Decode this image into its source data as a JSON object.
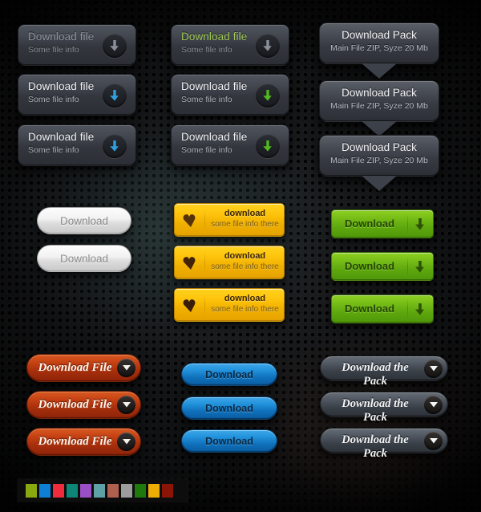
{
  "meta": {
    "title": "Download Buttons UI Kit",
    "background_style": "dark perforated metal texture"
  },
  "column_dark_blue": {
    "name": "Dark buttons with blue arrow",
    "buttons": [
      {
        "title": "Download file",
        "subtitle": "Some file info",
        "state": "disabled",
        "icon": "download-arrow-icon",
        "arrow_color": "#8a8f98"
      },
      {
        "title": "Download file",
        "subtitle": "Some file info",
        "state": "hover",
        "icon": "download-arrow-icon",
        "arrow_color": "#2f9fe0"
      },
      {
        "title": "Download file",
        "subtitle": "Some file info",
        "state": "active",
        "icon": "download-arrow-icon",
        "arrow_color": "#2f9fe0"
      }
    ]
  },
  "column_dark_green": {
    "name": "Dark buttons with green arrow",
    "buttons": [
      {
        "title": "Download file",
        "subtitle": "Some file info",
        "state": "disabled",
        "icon": "download-arrow-icon",
        "arrow_color": "#8a8f98",
        "title_color": "#9dc559"
      },
      {
        "title": "Download file",
        "subtitle": "Some file info",
        "state": "hover",
        "icon": "download-arrow-icon",
        "arrow_color": "#52b81f",
        "title_color": "#f2f3f5"
      },
      {
        "title": "Download file",
        "subtitle": "Some file info",
        "state": "active",
        "icon": "download-arrow-icon",
        "arrow_color": "#52b81f",
        "title_color": "#f2f3f5"
      }
    ]
  },
  "column_pack_tags": {
    "name": "Download Pack tag buttons",
    "buttons": [
      {
        "title": "Download Pack",
        "subtitle": "Main File ZIP, Syze 20 Mb"
      },
      {
        "title": "Download Pack",
        "subtitle": "Main File ZIP, Syze 20 Mb"
      },
      {
        "title": "Download Pack",
        "subtitle": "Main File ZIP, Syze 20 Mb"
      }
    ]
  },
  "white_pills": {
    "name": "White glossy pill buttons",
    "buttons": [
      {
        "label": "Download",
        "state": "normal"
      },
      {
        "label": "Download",
        "state": "pressed"
      }
    ]
  },
  "yellow_buttons": {
    "name": "Yellow download buttons",
    "icon": "heart-chevron-icon",
    "buttons": [
      {
        "label": "download",
        "subtitle": "some file info there",
        "state": "normal"
      },
      {
        "label": "download",
        "subtitle": "some file info there",
        "state": "hover"
      },
      {
        "label": "download",
        "subtitle": "some file info there",
        "state": "active"
      }
    ]
  },
  "green_buttons": {
    "name": "Green download buttons",
    "icon": "download-arrow-icon",
    "buttons": [
      {
        "label": "Download",
        "state": "normal"
      },
      {
        "label": "Download",
        "state": "hover"
      },
      {
        "label": "Download",
        "state": "active"
      }
    ]
  },
  "orange_pills": {
    "name": "Orange Download File pills",
    "icon": "chevron-down-icon",
    "buttons": [
      {
        "label": "Download File",
        "state": "normal"
      },
      {
        "label": "Download File",
        "state": "hover"
      },
      {
        "label": "Download File",
        "state": "active"
      }
    ]
  },
  "blue_pills": {
    "name": "Blue Download pills",
    "buttons": [
      {
        "label": "Download",
        "state": "normal"
      },
      {
        "label": "Download",
        "state": "hover"
      },
      {
        "label": "Download",
        "state": "active"
      }
    ]
  },
  "slate_pills": {
    "name": "Slate Download the Pack pills",
    "icon": "chevron-down-icon",
    "buttons": [
      {
        "label": "Download the Pack",
        "state": "normal"
      },
      {
        "label": "Download the Pack",
        "state": "hover"
      },
      {
        "label": "Download the Pack",
        "state": "active"
      }
    ]
  },
  "palette": {
    "name": "color-swatch-strip",
    "swatches": [
      {
        "name": "olive-green",
        "hex": "#8aa80f"
      },
      {
        "name": "azure-blue",
        "hex": "#0e7fd4"
      },
      {
        "name": "crimson-red",
        "hex": "#f02c3c"
      },
      {
        "name": "teal",
        "hex": "#0d8577"
      },
      {
        "name": "purple",
        "hex": "#9b4fc4"
      },
      {
        "name": "steel-teal",
        "hex": "#5ea2a8"
      },
      {
        "name": "brick-rose",
        "hex": "#b0604f"
      },
      {
        "name": "gray",
        "hex": "#9d9d9d"
      },
      {
        "name": "forest-green",
        "hex": "#1f7a0d"
      },
      {
        "name": "golden-yellow",
        "hex": "#ecae05"
      },
      {
        "name": "dark-red",
        "hex": "#8a1405"
      }
    ]
  }
}
